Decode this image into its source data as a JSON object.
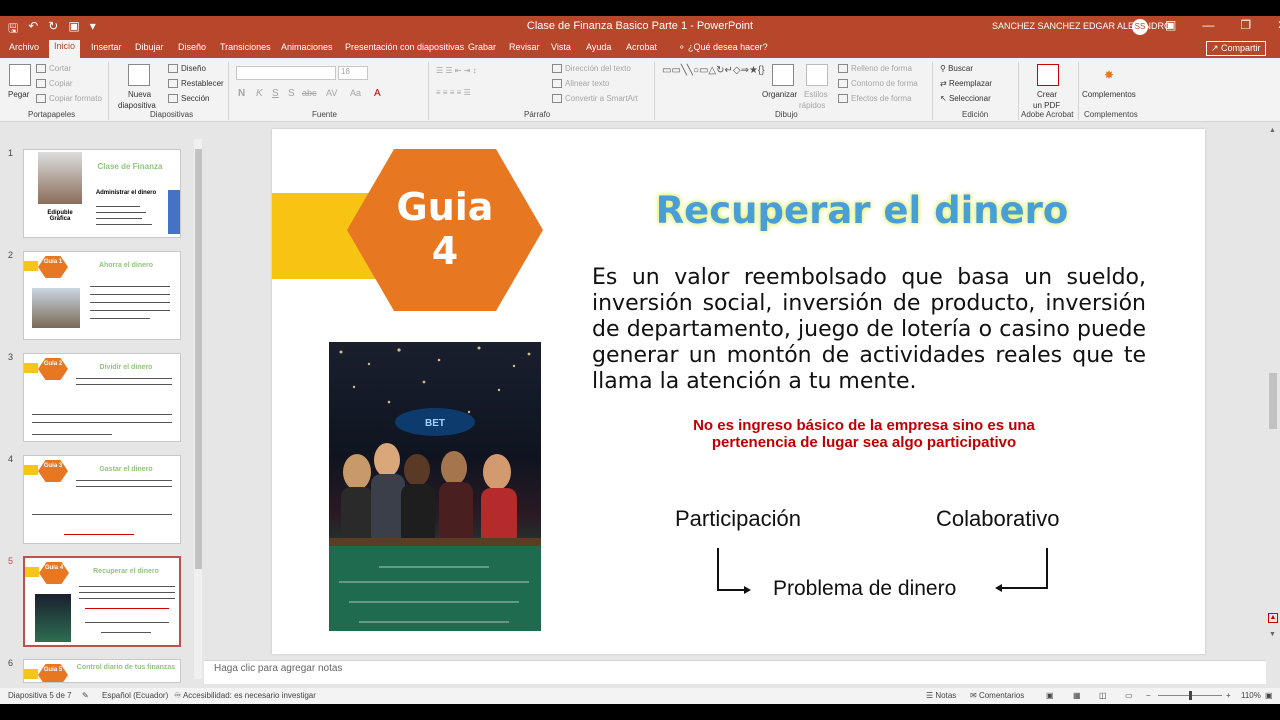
{
  "window": {
    "title": "Clase de Finanza Basico Parte 1  -  PowerPoint",
    "user": "SANCHEZ SANCHEZ EDGAR ALEJANDRO",
    "user_initials": "SS"
  },
  "menu": {
    "tabs": [
      "Archivo",
      "Inicio",
      "Insertar",
      "Dibujar",
      "Diseño",
      "Transiciones",
      "Animaciones",
      "Presentación con diapositivas",
      "Grabar",
      "Revisar",
      "Vista",
      "Ayuda",
      "Acrobat",
      "¿Qué desea hacer?"
    ],
    "active_tab": "Inicio",
    "share_label": "Compartir"
  },
  "ribbon": {
    "portapapeles": {
      "group": "Portapapeles",
      "pegar": "Pegar",
      "cortar": "Cortar",
      "copiar": "Copiar",
      "copiar_formato": "Copiar formato"
    },
    "diapositivas": {
      "group": "Diapositivas",
      "nueva": "Nueva",
      "diapositiva": "diapositiva",
      "diseno": "Diseño",
      "restablecer": "Restablecer",
      "seccion": "Sección"
    },
    "fuente": {
      "group": "Fuente",
      "size": "18",
      "bold": "N",
      "italic": "K",
      "underline": "S",
      "strike": "S",
      "shadow": "abc",
      "spacing": "AV",
      "case": "Aa",
      "color": "A"
    },
    "parrafo": {
      "group": "Párrafo",
      "direccion": "Dirección del texto",
      "alinear": "Alinear texto",
      "smartart": "Convertir a SmartArt"
    },
    "dibujo": {
      "group": "Dibujo",
      "organizar": "Organizar",
      "estilos": "Estilos",
      "rapidos": "rápidos",
      "relleno": "Relleno de forma",
      "contorno": "Contorno de forma",
      "efectos": "Efectos de forma"
    },
    "edicion": {
      "group": "Edición",
      "buscar": "Buscar",
      "reemplazar": "Reemplazar",
      "seleccionar": "Seleccionar"
    },
    "acrobat": {
      "group": "Adobe Acrobat",
      "crear": "Crear",
      "pdf": "un PDF"
    },
    "complementos": {
      "group": "Complementos",
      "label": "Complementos"
    }
  },
  "thumbnails": [
    {
      "num": "1",
      "title": "Clase de Finanza",
      "subtitle": "Administrar el dinero",
      "caption": "Edipuble Gráfica"
    },
    {
      "num": "2",
      "badge": "Guia 1",
      "title": "Ahorra el dinero"
    },
    {
      "num": "3",
      "badge": "Guia 2",
      "title": "Dividir el dinero"
    },
    {
      "num": "4",
      "badge": "Guia 3",
      "title": "Gastar el dinero"
    },
    {
      "num": "5",
      "badge": "Guia 4",
      "title": "Recuperar el dinero"
    },
    {
      "num": "6",
      "badge": "Guia 5",
      "title": "Control diario de tus finanzas"
    }
  ],
  "slide": {
    "badge_line1": "Guia",
    "badge_line2": "4",
    "title": "Recuperar el dinero",
    "body": "Es un valor reembolsado que basa un sueldo, inversión social, inversión de producto, inversión de departamento, juego de lotería o casino puede generar un montón de actividades reales que te llama la atención a tu mente.",
    "highlight_line1": "No es ingreso básico de la empresa sino es una",
    "highlight_line2": "pertenencia de lugar sea algo participativo",
    "diagram": {
      "left": "Participación",
      "right": "Colaborativo",
      "center": "Problema de dinero"
    },
    "photo_sign": "BET"
  },
  "notes_placeholder": "Haga clic para agregar notas",
  "status": {
    "slide_count": "Diapositiva 5 de 7",
    "language": "Español (Ecuador)",
    "accessibility": "Accesibilidad: es necesario investigar",
    "notas": "Notas",
    "comentarios": "Comentarios",
    "zoom": "110%"
  },
  "colors": {
    "accent": "#b7472a",
    "hex_orange": "#e87722",
    "yellow": "#f8c414",
    "title_blue": "#4a9ed8",
    "red": "#c00000"
  }
}
